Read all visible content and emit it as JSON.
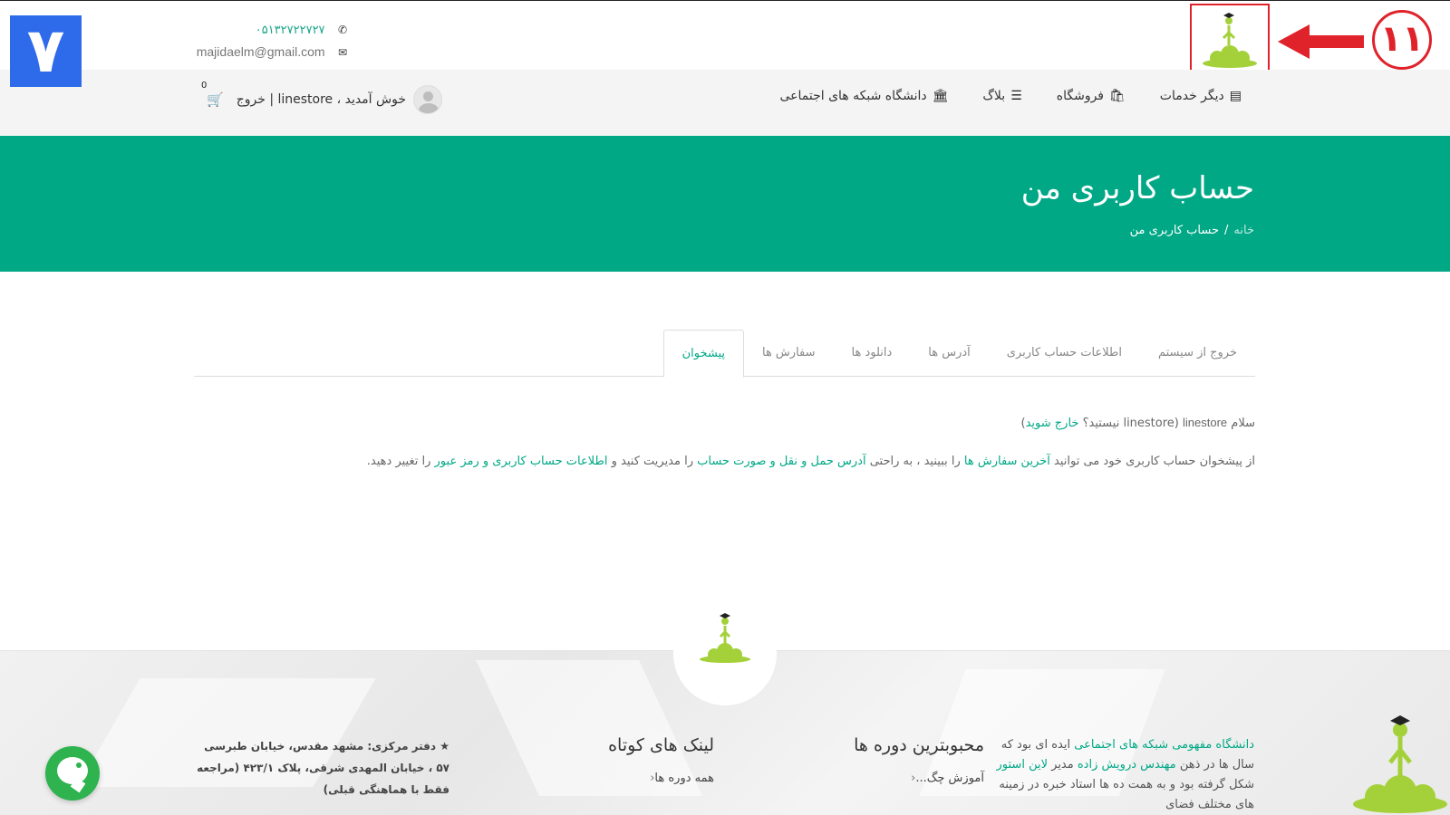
{
  "badge": {
    "left_number": "۷",
    "annotation_number": "۱۱"
  },
  "contact": {
    "phone": "۰۵۱۳۲۷۲۲۷۲۷",
    "email": "majidaelm@gmail.com"
  },
  "icons": {
    "phone": "phone-icon",
    "email": "envelope-icon",
    "university": "university-icon",
    "blog": "sitemap-icon",
    "shop": "shopping-bag-icon",
    "services": "id-card-icon",
    "cart": "cart-icon",
    "avatar": "user-avatar-icon",
    "chat": "chat-icon"
  },
  "colors": {
    "brand": "#00a886",
    "annotation": "#e0222a",
    "badge": "#2d6bea",
    "chat": "#2eb34f",
    "logo_green": "#a4d13a"
  },
  "nav": {
    "items": [
      {
        "label": "دانشگاه شبکه های اجتماعی",
        "icon": "university-icon"
      },
      {
        "label": "بلاگ",
        "icon": "sitemap-icon"
      },
      {
        "label": "فروشگاه",
        "icon": "shopping-bag-icon"
      },
      {
        "label": "دیگر خدمات",
        "icon": "id-card-icon"
      }
    ],
    "user": {
      "greeting": "خوش آمدید ، linestore | خروج",
      "cart_count": "0"
    }
  },
  "hero": {
    "title": "حساب کاربری من",
    "breadcrumb": {
      "home": "خانه",
      "separator": "/",
      "current": "حساب کاربری من"
    }
  },
  "tabs": {
    "items": [
      {
        "label": "پیشخوان",
        "active": true
      },
      {
        "label": "سفارش ها",
        "active": false
      },
      {
        "label": "دانلود ها",
        "active": false
      },
      {
        "label": "آدرس ها",
        "active": false
      },
      {
        "label": "اطلاعات حساب کاربری",
        "active": false
      },
      {
        "label": "خروج از سیستم",
        "active": false
      }
    ]
  },
  "dashboard": {
    "hello_prefix": "سلام",
    "hello_user": "linestore",
    "hello_mid": "(linestore نیستید؟",
    "hello_logout_link": "خارج شوید",
    "hello_end": ")",
    "p2_a": "از پیشخوان حساب کاربری خود می توانید",
    "p2_link1": "آخرین سفارش ها",
    "p2_b": "را ببینید ، به راحتی",
    "p2_link2": "آدرس حمل و نقل و صورت حساب",
    "p2_c": "را مدیریت کنید و",
    "p2_link3": "اطلاعات حساب کاربری و رمز عبور",
    "p2_d": "را تغییر دهید."
  },
  "footer": {
    "about": {
      "link1": "دانشگاه مفهومی شبکه های اجتماعی",
      "text1": "ایده ای بود که سال ها در ذهن",
      "link2": "مهندس درویش زاده",
      "text2": "مدیر",
      "link3": "لاین استور",
      "text3": "شکل گرفته بود و به همت ده ها استاد خبره در زمینه های مختلف فضای"
    },
    "popular": {
      "heading": "محبوبترین دوره ها",
      "items": [
        "آموزش چگ..."
      ]
    },
    "links": {
      "heading": "لینک های کوتاه",
      "items": [
        "همه دوره ها"
      ]
    },
    "address": "★ دفتر مرکزی: مشهد مقدس، خیابان طبرسی ۵۷ ، خیابان المهدی شرقی، پلاک ۴۲۳/۱ (مراجعه فقط با هماهنگی قبلی)"
  }
}
